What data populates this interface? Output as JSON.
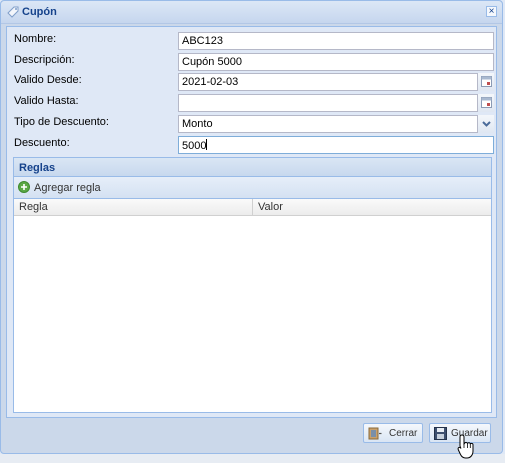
{
  "window": {
    "title": "Cupón",
    "close_symbol": "×"
  },
  "form": {
    "nombre": {
      "label": "Nombre:",
      "value": "ABC123"
    },
    "descripcion": {
      "label": "Descripción:",
      "value": "Cupón 5000"
    },
    "valido_desde": {
      "label": "Valido Desde:",
      "value": "2021-02-03"
    },
    "valido_hasta": {
      "label": "Valido Hasta:",
      "value": ""
    },
    "tipo_descuento": {
      "label": "Tipo de Descuento:",
      "value": "Monto"
    },
    "descuento": {
      "label": "Descuento:",
      "value": "5000"
    }
  },
  "rules_grid": {
    "title": "Reglas",
    "add_label": "Agregar regla",
    "columns": [
      "Regla",
      "Valor"
    ],
    "rows": []
  },
  "footer": {
    "close_label": "Cerrar",
    "save_label": "Guardar"
  },
  "colors": {
    "title_text": "#15428b",
    "window_border": "#99bbe8",
    "body_bg": "#dfe8f6"
  },
  "icons": [
    "tag-icon",
    "close-icon",
    "calendar-icon",
    "chevron-down-icon",
    "add-icon",
    "close-door-icon",
    "save-icon",
    "hand-cursor-icon"
  ]
}
